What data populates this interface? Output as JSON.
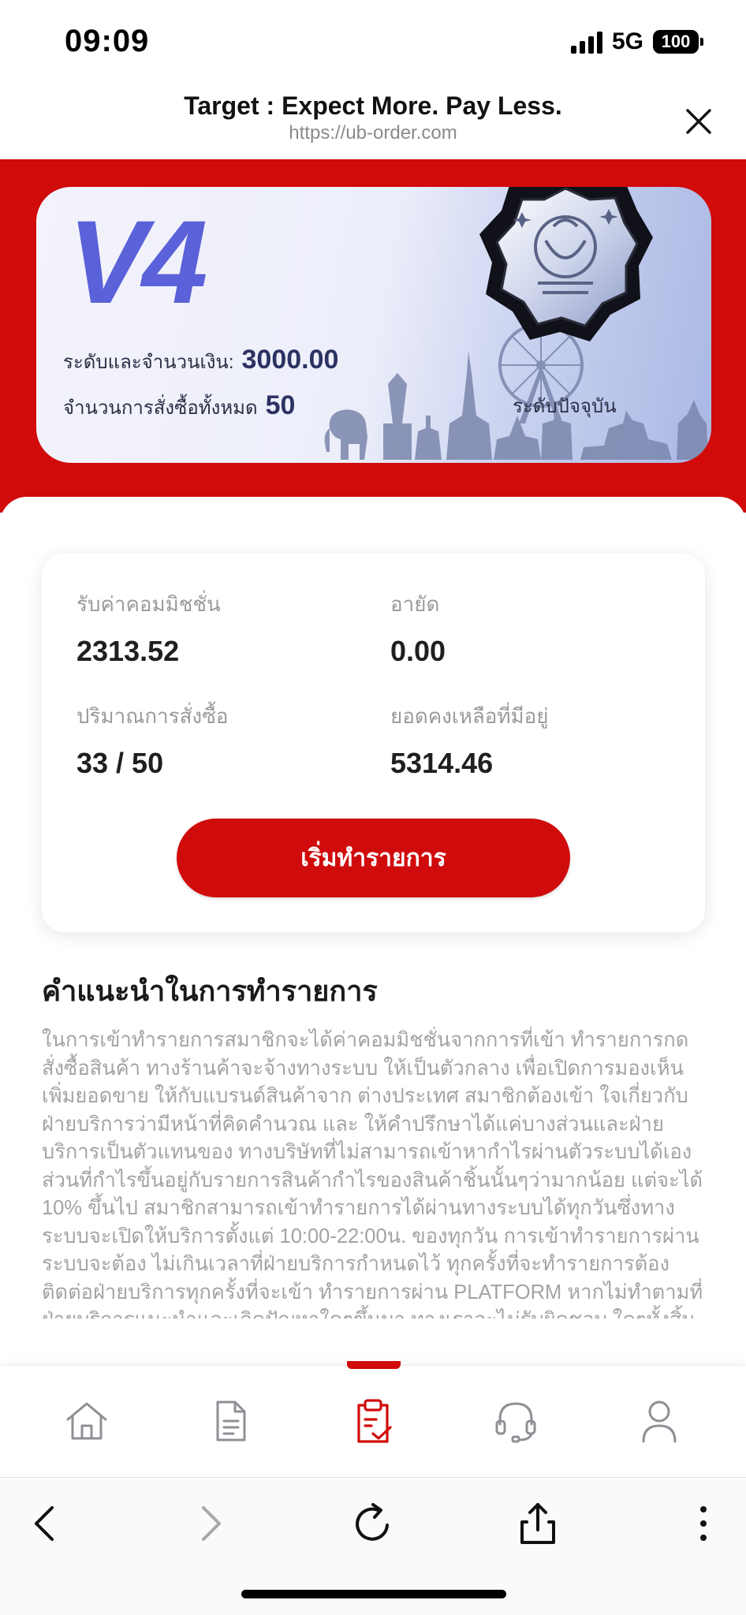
{
  "status_bar": {
    "time": "09:09",
    "network": "5G",
    "battery": "100"
  },
  "browser": {
    "title": "Target : Expect More. Pay Less.",
    "url": "https://ub-order.com"
  },
  "vip_card": {
    "level": "V4",
    "amount_label": "ระดับและจำนวนเงิน:",
    "amount_value": "3000.00",
    "orders_label": "จำนวนการสั่งซื้อทั้งหมด",
    "orders_value": "50",
    "current_level_label": "ระดับปัจจุบัน"
  },
  "stats": {
    "commission_label": "รับค่าคอมมิชชั่น",
    "commission_value": "2313.52",
    "frozen_label": "อายัด",
    "frozen_value": "0.00",
    "order_count_label": "ปริมาณการสั่งซื้อ",
    "order_count_value": "33 / 50",
    "balance_label": "ยอดคงเหลือที่มีอยู่",
    "balance_value": "5314.46"
  },
  "start_button_label": "เริ่มทำรายการ",
  "guide": {
    "title": "คำแนะนำในการทำรายการ",
    "text": "ในการเข้าทำรายการสมาชิกจะได้ค่าคอมมิชชั่นจากการที่เข้า ทำรายการกดสั่งซื้อสินค้า ทางร้านค้าจะจ้างทางระบบ ให้เป็นตัวกลาง เพื่อเปิดการมองเห็นเพิ่มยอดขาย ให้กับแบรนด์สินค้าจาก ต่างประเทศ สมาชิกต้องเข้า ใจเกี่ยวกับฝ่ายบริการว่ามีหน้าที่คิดคำนวณ และ ให้คำปรึกษาได้แค่บางส่วนและฝ่ายบริการเป็นตัวแทนของ ทางบริษัทที่ไม่สามารถเข้าหากำไรผ่านตัวระบบได้เอง ส่วนที่กำไรขึ้นอยู่กับรายการสินค้ากำไรของสินค้าชิ้นนั้นๆว่ามากน้อย แต่จะได้ 10% ขึ้นไป สมาชิกสามารถเข้าทำรายการได้ผ่านทางระบบได้ทุกวันซึ่งทางระบบจะเปิดให้บริการตั้งแต่ 10:00-22:00น. ของทุกวัน การเข้าทำรายการผ่านระบบจะต้อง ไม่เกินเวลาที่ฝ่ายบริการกำหนดไว้ ทุกครั้งที่จะทำรายการต้องติดต่อฝ่ายบริการทุกครั้งที่จะเข้า ทำรายการผ่าน PLATFORM หากไม่ทำตามที่ฝ่ายบริการแนะนำและเกิดปัญหาใดๆขึ้นมา ทางเราจะไม่รับผิดชอบ ใดๆทั้งสิ้น ถ้าเกิดสมาชิกมีการผิดกฎระบบอาจจะมีการ ระงับ บัญชีของสมาชิก ในส่วนนี้ให้ติดต่อทางฝ่ายบริการ"
  },
  "tabs": [
    {
      "name": "home",
      "icon": "home-icon"
    },
    {
      "name": "records",
      "icon": "document-icon"
    },
    {
      "name": "orders",
      "icon": "clipboard-check-icon",
      "active": true
    },
    {
      "name": "support",
      "icon": "headset-icon"
    },
    {
      "name": "profile",
      "icon": "user-icon"
    }
  ],
  "colors": {
    "brand_red": "#d10a0a",
    "vip_blue": "#5b61d8",
    "muted_text": "#a3a3a3"
  }
}
